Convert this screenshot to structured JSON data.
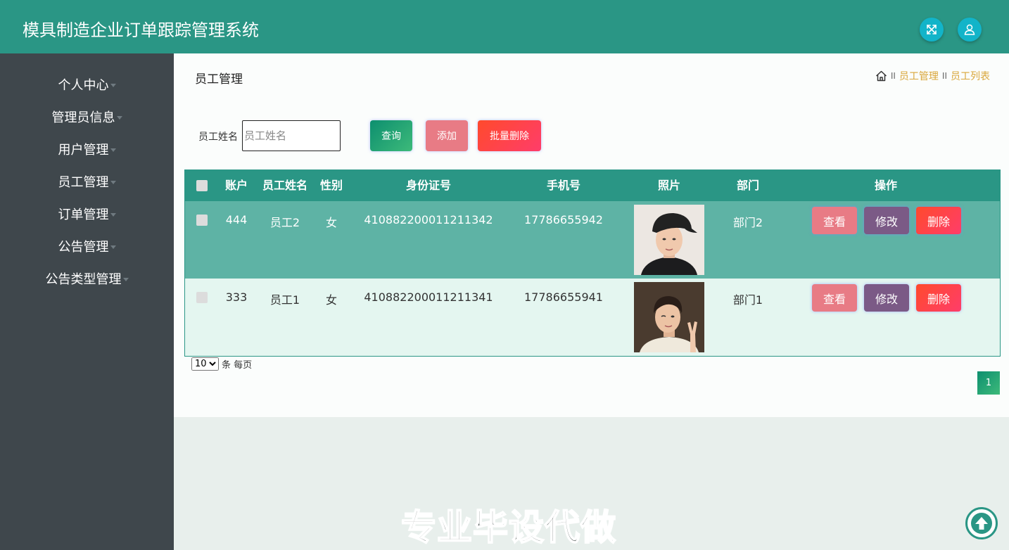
{
  "header": {
    "title": "模具制造企业订单跟踪管理系统",
    "fullscreen_icon": "fullscreen-icon",
    "user_icon": "user-icon",
    "accent": "#2a9685"
  },
  "sidebar": {
    "items": [
      {
        "label": "个人中心"
      },
      {
        "label": "管理员信息"
      },
      {
        "label": "用户管理"
      },
      {
        "label": "员工管理"
      },
      {
        "label": "订单管理"
      },
      {
        "label": "公告管理"
      },
      {
        "label": "公告类型管理"
      }
    ]
  },
  "page": {
    "title": "员工管理",
    "breadcrumb": {
      "home_icon": "home-icon",
      "separator": "II",
      "items": [
        "员工管理",
        "员工列表"
      ]
    }
  },
  "search": {
    "label": "员工姓名",
    "placeholder": "员工姓名",
    "value": "",
    "query_label": "查询",
    "add_label": "添加",
    "batch_delete_label": "批量删除"
  },
  "table": {
    "headers": {
      "account": "账户",
      "name": "员工姓名",
      "gender": "性别",
      "id_card": "身份证号",
      "phone": "手机号",
      "photo": "照片",
      "dept": "部门",
      "ops": "操作"
    },
    "rows": [
      {
        "account": "444",
        "name": "员工2",
        "gender": "女",
        "id_card": "410882200011211342",
        "phone": "17786655942",
        "dept": "部门2"
      },
      {
        "account": "333",
        "name": "员工1",
        "gender": "女",
        "id_card": "410882200011211341",
        "phone": "17786655941",
        "dept": "部门1"
      }
    ],
    "actions": {
      "view": "查看",
      "edit": "修改",
      "delete": "删除"
    }
  },
  "pagination": {
    "page_size": "10",
    "page_size_options": [
      "10"
    ],
    "per_page_label": "条 每页",
    "current_page": "1"
  },
  "watermark": "专业毕设代做",
  "back_to_top_icon": "arrow-up-icon"
}
